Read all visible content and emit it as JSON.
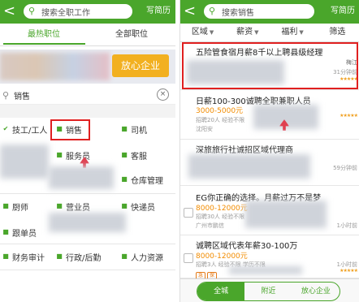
{
  "left": {
    "back": "<",
    "search_placeholder": "搜索全职工作",
    "resume_btn": "写简历",
    "tabs": [
      "最热职位",
      "全部职位"
    ],
    "banner_btn": "放心企业",
    "keyword": "销售",
    "clear": "×",
    "categories": [
      {
        "label": "技工/工人",
        "icon": "tool-icon"
      },
      {
        "label": "销售",
        "icon": "person-icon"
      },
      {
        "label": "司机",
        "icon": "car-icon"
      },
      {
        "label": "服务员",
        "icon": "tray-icon"
      },
      {
        "label": "客服",
        "icon": "headset-icon"
      },
      {
        "label": "仓库管理",
        "icon": "box-icon"
      },
      {
        "label": "厨师",
        "icon": "chef-icon"
      },
      {
        "label": "营业员",
        "icon": "store-icon"
      },
      {
        "label": "快递员",
        "icon": "parcel-icon"
      },
      {
        "label": "跟单员",
        "icon": "doc-icon"
      },
      {
        "label": "财务审计",
        "icon": "calc-icon"
      },
      {
        "label": "行政/后勤",
        "icon": "building-icon"
      },
      {
        "label": "人力资源",
        "icon": "people-icon"
      }
    ]
  },
  "right": {
    "back": "<",
    "search_text": "搜索销售",
    "resume_btn": "写简历",
    "filters": [
      "区域",
      "薪资",
      "福利",
      "筛选"
    ],
    "jobs": [
      {
        "title": "五险管食宿月薪8千以上聘县级经理",
        "salary": "",
        "meta": "",
        "city": "梅江",
        "time": "31分钟前",
        "stars": "★★★★★"
      },
      {
        "title": "日薪100-300诚聘全职兼职人员",
        "salary": "3000-5000元",
        "meta": "招聘20人 经验不限",
        "city": "沈阳安",
        "time": "",
        "stars": "★★★★★"
      },
      {
        "title": "深旅旅行社诚招区域代理商",
        "salary": "",
        "meta": "",
        "city": "",
        "time": "59分钟前",
        "stars": ""
      },
      {
        "title": "EG你正确的选择。月薪过万不是梦",
        "salary": "8000-12000元",
        "meta": "招聘30人 经验不限",
        "city": "广州市鹏信",
        "time": "1小时前",
        "stars": ""
      },
      {
        "title": "诚聘区域代表年薪30-100万",
        "salary": "8000-12000元",
        "meta": "招聘3人 经验不限 学历不限",
        "city": "",
        "time": "1小时前",
        "stars": "★★★★★"
      }
    ],
    "bottom_tabs": [
      "全城",
      "附近",
      "放心企业"
    ],
    "badges": [
      "急",
      "保"
    ]
  },
  "colors": {
    "accent": "#4aa62b",
    "highlight": "#e02020",
    "salary": "#f28c00",
    "banner_btn": "#f2b020"
  }
}
